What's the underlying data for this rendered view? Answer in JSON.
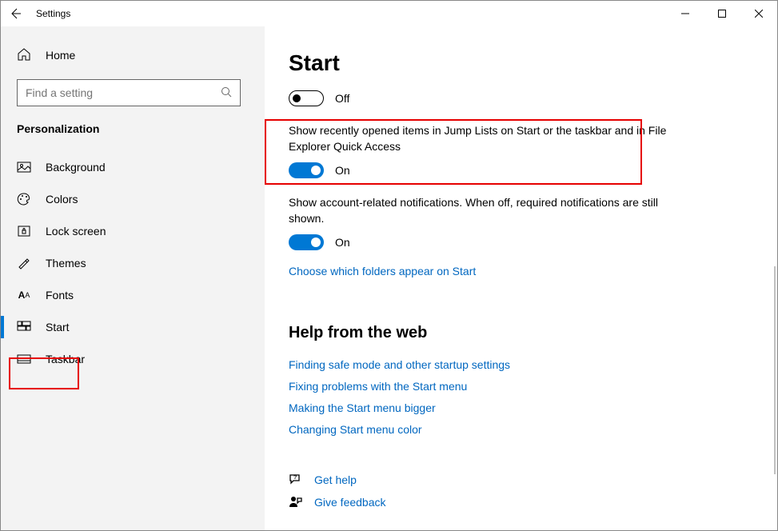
{
  "window": {
    "title": "Settings"
  },
  "sidebar": {
    "home": "Home",
    "search_placeholder": "Find a setting",
    "section": "Personalization",
    "items": [
      {
        "label": "Background"
      },
      {
        "label": "Colors"
      },
      {
        "label": "Lock screen"
      },
      {
        "label": "Themes"
      },
      {
        "label": "Fonts"
      },
      {
        "label": "Start"
      },
      {
        "label": "Taskbar"
      }
    ]
  },
  "page": {
    "title": "Start",
    "settings": [
      {
        "state": "Off"
      },
      {
        "label": "Show recently opened items in Jump Lists on Start or the taskbar and in File Explorer Quick Access",
        "state": "On"
      },
      {
        "label": "Show account-related notifications. When off, required notifications are still shown.",
        "state": "On"
      }
    ],
    "choose_folders": "Choose which folders appear on Start",
    "help_head": "Help from the web",
    "help_links": [
      "Finding safe mode and other startup settings",
      "Fixing problems with the Start menu",
      "Making the Start menu bigger",
      "Changing Start menu color"
    ],
    "footer": {
      "get_help": "Get help",
      "feedback": "Give feedback"
    }
  }
}
